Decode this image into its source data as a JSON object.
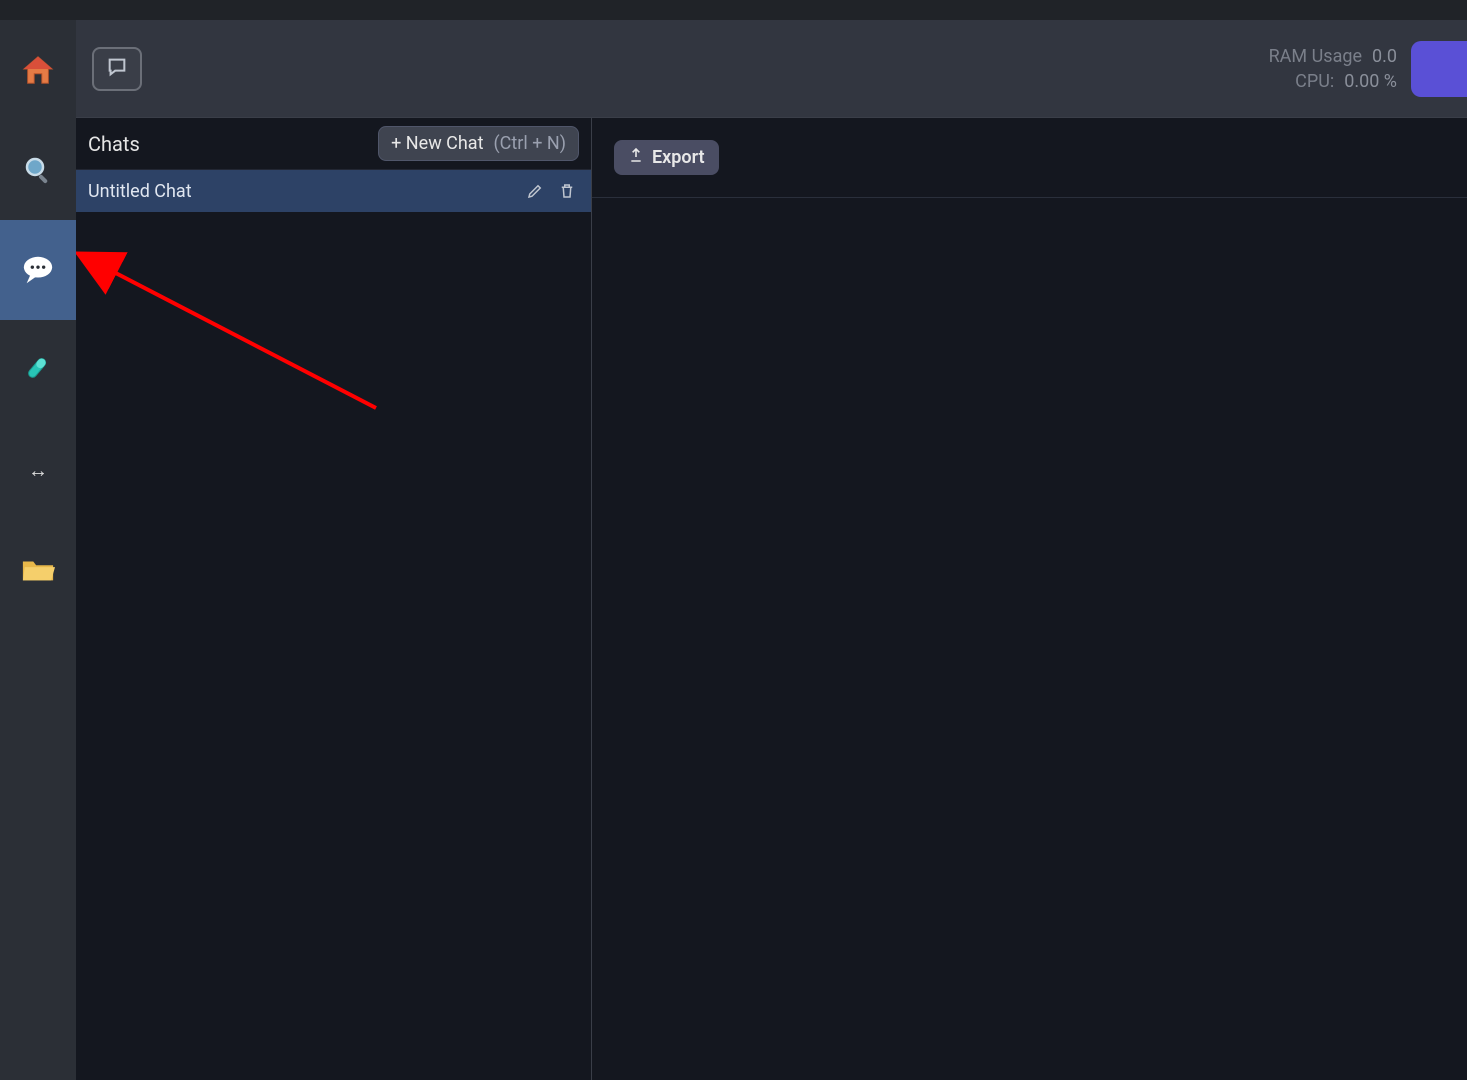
{
  "topbar": {
    "ram_label": "RAM Usage",
    "ram_value": "0.0",
    "cpu_label": "CPU:",
    "cpu_value": "0.00 %"
  },
  "chats_panel": {
    "title": "Chats",
    "new_chat_label": "+ New Chat",
    "new_chat_shortcut": "(Ctrl + N)"
  },
  "chat_items": [
    {
      "title": "Untitled Chat"
    }
  ],
  "main_pane": {
    "export_label": "Export"
  },
  "sidebar_rail": {
    "items": [
      "home",
      "search",
      "chat",
      "lab",
      "resize",
      "folder"
    ]
  }
}
